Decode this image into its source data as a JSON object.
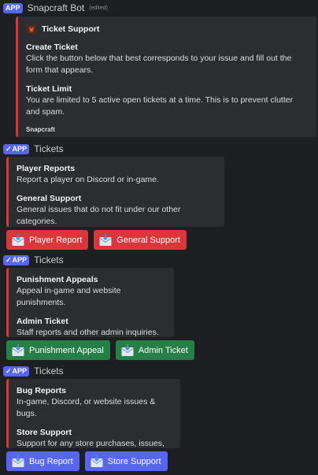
{
  "msg1": {
    "app_tag": "APP",
    "author": "Snapcraft Bot",
    "edited": "(edited)",
    "embed": {
      "author_name": "Ticket Support",
      "fields": [
        {
          "name": "Create Ticket",
          "value": "Click the button below that best corresponds to your issue and fill out the form that appears."
        },
        {
          "name": "Ticket Limit",
          "value": "You are limited to 5 active open tickets at a time. This is to prevent clutter and spam."
        }
      ],
      "footer": "Snapcraft"
    }
  },
  "msg2": {
    "app_tag": "APP",
    "author": "Tickets",
    "fields": [
      {
        "name": "Player Reports",
        "value": "Report a player on Discord or in-game."
      },
      {
        "name": "General Support",
        "value": "General issues that do not fit under our other categories."
      }
    ],
    "buttons": [
      "Player Report",
      "General Support"
    ]
  },
  "msg3": {
    "app_tag": "APP",
    "author": "Tickets",
    "fields": [
      {
        "name": "Punishment Appeals",
        "value": "Appeal in-game and website punishments."
      },
      {
        "name": "Admin Ticket",
        "value": "Staff reports and other admin inquiries."
      }
    ],
    "buttons": [
      "Punishment Appeal",
      "Admin Ticket"
    ]
  },
  "msg4": {
    "app_tag": "APP",
    "author": "Tickets",
    "fields": [
      {
        "name": "Bug Reports",
        "value": "In-game, Discord, or website issues & bugs."
      },
      {
        "name": "Store Support",
        "value": "Support for any store purchases, issues, etc."
      }
    ],
    "buttons": [
      "Bug Report",
      "Store Support"
    ]
  },
  "colors": {
    "embed_border": "#da373c",
    "button_red": "#da373c",
    "button_green": "#248046",
    "button_blue": "#5865f2",
    "app_tag": "#5865f2"
  },
  "icons": {
    "button_icon": "envelope-icon",
    "embed_author_icon": "snapcraft-logo"
  }
}
